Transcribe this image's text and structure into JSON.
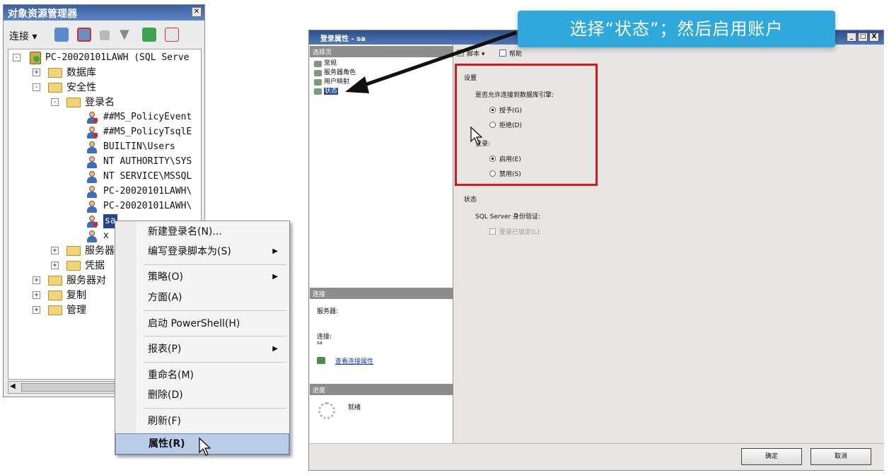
{
  "object_explorer": {
    "title": "对象资源管理器",
    "connect_label": "连接 ▾",
    "tree": {
      "server": "PC-20020101LAWH (SQL Serve",
      "databases": "数据库",
      "security": "安全性",
      "logins_folder": "登录名",
      "logins": [
        "##MS_PolicyEvent",
        "##MS_PolicyTsqlE",
        "BUILTIN\\Users",
        "NT AUTHORITY\\SYS",
        "NT SERVICE\\MSSQL",
        "PC-20020101LAWH\\",
        "PC-20020101LAWH\\",
        "sa",
        "x"
      ],
      "server_roles": "服务器",
      "credentials": "凭据",
      "server_objects": "服务器对",
      "replication": "复制",
      "management": "管理"
    }
  },
  "context_menu": {
    "items": [
      {
        "label": "新建登录名(N)...",
        "submenu": false
      },
      {
        "label": "编写登录脚本为(S)",
        "submenu": true
      },
      {
        "label": "策略(O)",
        "submenu": true
      },
      {
        "label": "方面(A)",
        "submenu": false
      },
      {
        "label": "启动 PowerShell(H)",
        "submenu": false
      },
      {
        "label": "报表(P)",
        "submenu": true
      },
      {
        "label": "重命名(M)",
        "submenu": false
      },
      {
        "label": "删除(D)",
        "submenu": false
      },
      {
        "label": "刷新(F)",
        "submenu": false
      },
      {
        "label": "属性(R)",
        "submenu": false
      }
    ],
    "arrow": "▶"
  },
  "dialog": {
    "title": "登录属性 - sa",
    "select_page_header": "选择页",
    "pages": [
      "常规",
      "服务器角色",
      "用户映射",
      "状态"
    ],
    "toolbar": {
      "script": "脚本 ▾",
      "help": "帮助"
    },
    "settings_header": "设置",
    "permission_label": "是否允许连接到数据库引擎:",
    "grant_label": "授予(G)",
    "deny_label": "拒绝(D)",
    "login_label": "登录:",
    "enabled_label": "启用(E)",
    "disabled_label": "禁用(S)",
    "status_header": "状态",
    "sql_auth_label": "SQL Server 身份验证:",
    "locked_label": "登录已锁定(L)",
    "connection_header": "连接",
    "server_label": "服务器:",
    "server_value": "",
    "connection_label": "连接:",
    "connection_value": "sa",
    "view_conn_props": "查看连接属性",
    "progress_header": "进度",
    "progress_status": "就绪",
    "ok_label": "确定",
    "cancel_label": "取消",
    "min": "_",
    "max": "□",
    "close": "X"
  },
  "callout": {
    "text": "选择“状态”；然后启用账户"
  },
  "colors": {
    "callout": "#2fa8dc",
    "highlight_box": "#d8171f",
    "title_bar": "#3a5f9e"
  }
}
